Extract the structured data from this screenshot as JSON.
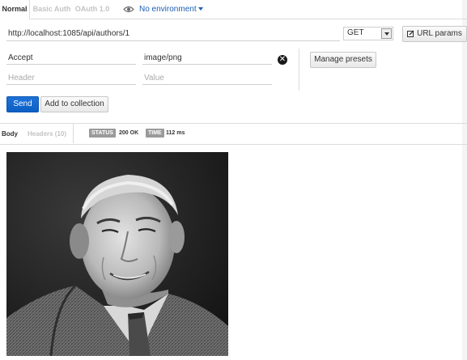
{
  "auth_tabs": [
    {
      "label": "Normal"
    },
    {
      "label": "Basic Auth"
    },
    {
      "label": "OAuth 1.0"
    }
  ],
  "environment": {
    "label": "No environment",
    "icon": "eye-icon"
  },
  "request": {
    "url": "http://localhost:1085/api/authors/1",
    "method": "GET",
    "url_params_label": "URL params"
  },
  "headers": {
    "rows": [
      {
        "key": "Accept",
        "value": "image/png"
      }
    ],
    "key_placeholder": "Header",
    "value_placeholder": "Value",
    "manage_presets_label": "Manage presets"
  },
  "actions": {
    "send_label": "Send",
    "add_to_collection_label": "Add to collection"
  },
  "response": {
    "tabs": [
      {
        "label": "Body"
      },
      {
        "label": "Headers (10)"
      }
    ],
    "status_label": "STATUS",
    "status_value": "200 OK",
    "time_label": "TIME",
    "time_value": "112 ms"
  },
  "colors": {
    "primary_button": "#0b5fc4",
    "link": "#1c5fb6",
    "badge": "#9a9a9a"
  }
}
